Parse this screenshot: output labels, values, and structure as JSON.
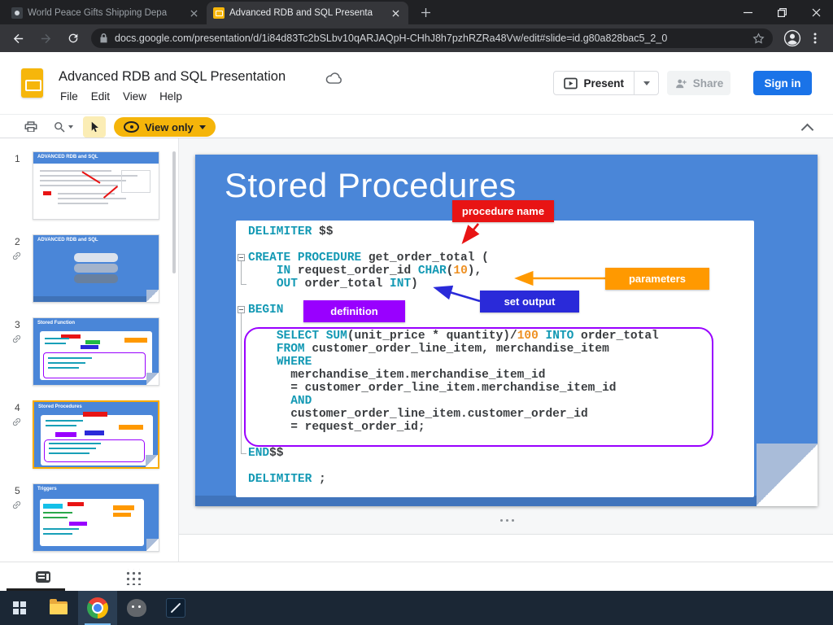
{
  "browser": {
    "tabs": [
      {
        "title": "World Peace Gifts Shipping Depa"
      },
      {
        "title": "Advanced RDB and SQL Presenta"
      }
    ],
    "url": "docs.google.com/presentation/d/1i84d83Tc2bSLbv10qARJAQpH-CHhJ8h7pzhRZRa48Vw/edit#slide=id.g80a828bac5_2_0"
  },
  "app": {
    "doc_title": "Advanced RDB and SQL Presentation",
    "menus": [
      "File",
      "Edit",
      "View",
      "Help"
    ],
    "present": "Present",
    "share": "Share",
    "sign_in": "Sign in",
    "view_only": "View only"
  },
  "filmstrip": [
    {
      "num": "1",
      "title": "ADVANCED RDB and SQL",
      "kind": "intro",
      "linked": false,
      "selected": false
    },
    {
      "num": "2",
      "title": "ADVANCED RDB and SQL",
      "kind": "database",
      "linked": true,
      "selected": false
    },
    {
      "num": "3",
      "title": "Stored Function",
      "kind": "codeA",
      "linked": true,
      "selected": false
    },
    {
      "num": "4",
      "title": "Stored Procedures",
      "kind": "codeB",
      "linked": true,
      "selected": true
    },
    {
      "num": "5",
      "title": "Triggers",
      "kind": "codeC",
      "linked": true,
      "selected": false
    }
  ],
  "slide": {
    "title": "Stored Procedures",
    "labels": {
      "procedure_name": "procedure name",
      "parameters": "parameters",
      "set_output": "set output",
      "definition": "definition"
    },
    "colors": {
      "slide_bg": "#4a86d8",
      "red": "#e81414",
      "orange": "#ff9900",
      "blue": "#2a2ad9",
      "purple": "#9900ff",
      "keyword": "#1399b4",
      "plain": "#3a3d40",
      "number": "#ee9022"
    },
    "code": [
      {
        "s": [
          [
            "k",
            "DELIMITER"
          ],
          [
            "p",
            " $$"
          ]
        ]
      },
      {
        "s": []
      },
      {
        "f": true,
        "s": [
          [
            "k",
            "CREATE PROCEDURE"
          ],
          [
            "p",
            " get_order_total ("
          ]
        ]
      },
      {
        "s": [
          [
            "p",
            "    "
          ],
          [
            "k",
            "IN"
          ],
          [
            "p",
            " request_order_id "
          ],
          [
            "k",
            "CHAR"
          ],
          [
            "p",
            "("
          ],
          [
            "n",
            "10"
          ],
          [
            "p",
            "),"
          ]
        ]
      },
      {
        "s": [
          [
            "p",
            "    "
          ],
          [
            "k",
            "OUT"
          ],
          [
            "p",
            " order_total "
          ],
          [
            "k",
            "INT"
          ],
          [
            "p",
            ")"
          ]
        ]
      },
      {
        "s": []
      },
      {
        "f": true,
        "s": [
          [
            "k",
            "BEGIN"
          ]
        ]
      },
      {
        "s": []
      },
      {
        "s": [
          [
            "p",
            "    "
          ],
          [
            "k",
            "SELECT"
          ],
          [
            "p",
            " "
          ],
          [
            "k",
            "SUM"
          ],
          [
            "p",
            "(unit_price * quantity)/"
          ],
          [
            "n",
            "100"
          ],
          [
            "p",
            " "
          ],
          [
            "k",
            "INTO"
          ],
          [
            "p",
            " order_total"
          ]
        ]
      },
      {
        "s": [
          [
            "p",
            "    "
          ],
          [
            "k",
            "FROM"
          ],
          [
            "p",
            " customer_order_line_item, merchandise_item"
          ]
        ]
      },
      {
        "s": [
          [
            "p",
            "    "
          ],
          [
            "k",
            "WHERE"
          ]
        ]
      },
      {
        "s": [
          [
            "p",
            "      merchandise_item.merchandise_item_id"
          ]
        ]
      },
      {
        "s": [
          [
            "p",
            "      = customer_order_line_item.merchandise_item_id"
          ]
        ]
      },
      {
        "s": [
          [
            "p",
            "      "
          ],
          [
            "k",
            "AND"
          ]
        ]
      },
      {
        "s": [
          [
            "p",
            "      customer_order_line_item.customer_order_id"
          ]
        ]
      },
      {
        "s": [
          [
            "p",
            "      = request_order_id;"
          ]
        ]
      },
      {
        "s": []
      },
      {
        "s": [
          [
            "k",
            "END"
          ],
          [
            "p",
            "$$"
          ]
        ]
      },
      {
        "s": []
      },
      {
        "s": [
          [
            "k",
            "DELIMITER"
          ],
          [
            "p",
            " ;"
          ]
        ]
      }
    ]
  },
  "icons": {
    "tab_close": "close-x",
    "new_tab": "plus",
    "minimize": "line",
    "restore": "double-square",
    "close": "x",
    "back": "arrow-left",
    "forward": "arrow-right",
    "reload": "circular-arrow",
    "lock": "padlock",
    "bookmark": "star-outline",
    "profile": "person-circle",
    "menu": "vertical-dots",
    "drive_status": "cloud",
    "present_play": "slideshow-play",
    "share": "person-add",
    "print": "printer",
    "zoom": "magnifier",
    "select_tool": "cursor-arrow",
    "view_only": "eye",
    "collapse": "chevron-up",
    "slide_link": "chain-link",
    "filmstrip_view": "filmstrip",
    "grid_view": "dot-grid",
    "start": "windows-logo",
    "explorer": "folder",
    "chrome": "chrome-ball",
    "gimp": "wilber",
    "pen_app": "stylus-tile"
  }
}
